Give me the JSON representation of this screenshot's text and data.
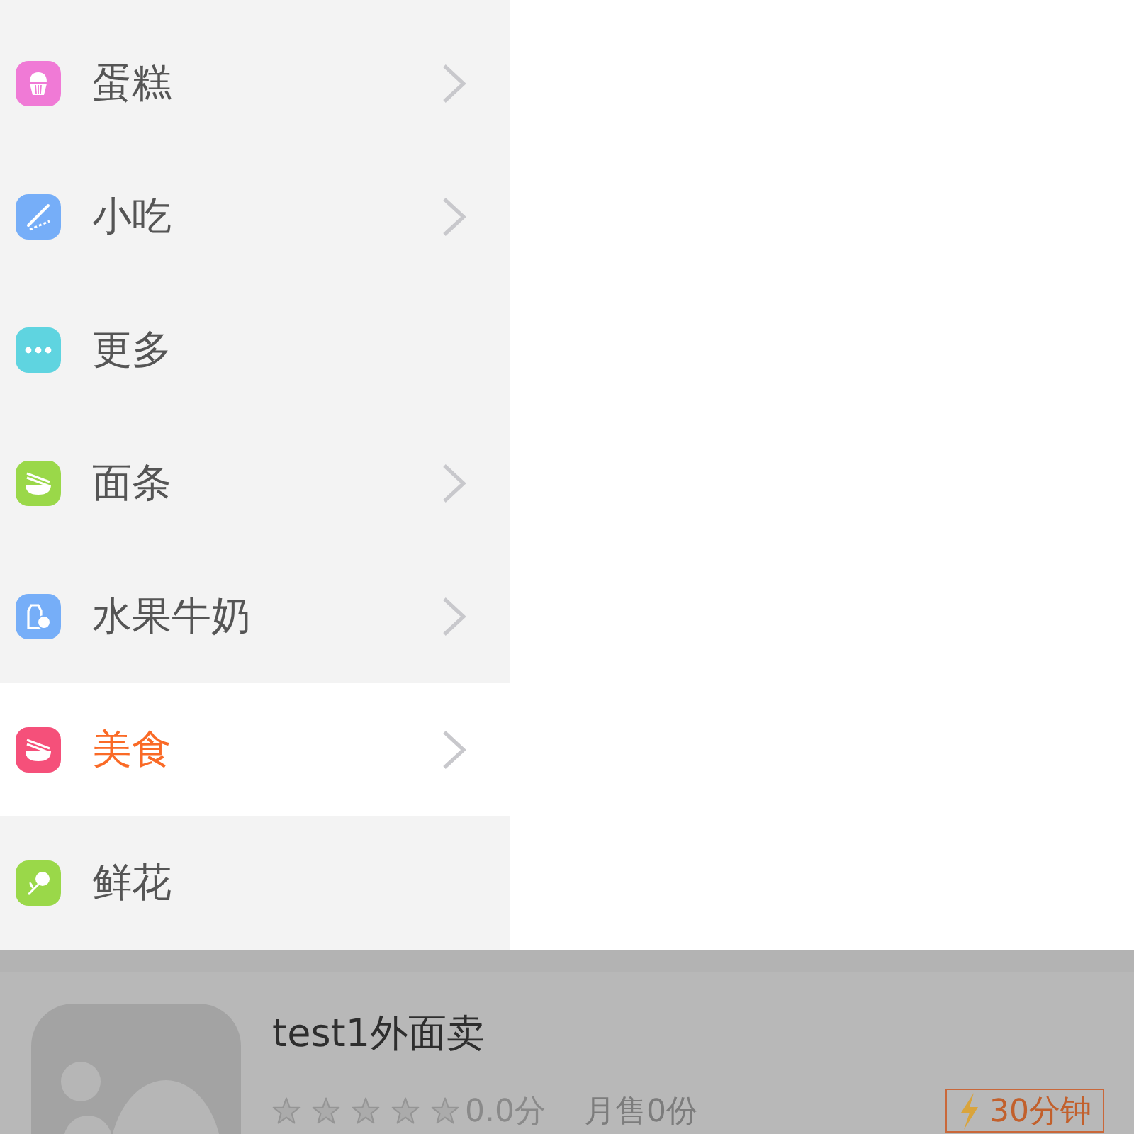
{
  "category_menu": {
    "items": [
      {
        "label": "蛋糕",
        "color": "#f07ad6",
        "has_submenu": true,
        "selected": false
      },
      {
        "label": "小吃",
        "color": "#76aef8",
        "has_submenu": true,
        "selected": false
      },
      {
        "label": "更多",
        "color": "#5fd4e0",
        "has_submenu": false,
        "selected": false
      },
      {
        "label": "面条",
        "color": "#9ad849",
        "has_submenu": true,
        "selected": false
      },
      {
        "label": "水果牛奶",
        "color": "#76aef8",
        "has_submenu": true,
        "selected": false
      },
      {
        "label": "美食",
        "color": "#f5507a",
        "has_submenu": true,
        "selected": true
      },
      {
        "label": "鲜花",
        "color": "#9ad849",
        "has_submenu": false,
        "selected": false
      }
    ]
  },
  "shop_card": {
    "name": "test1外面卖",
    "stars": 0,
    "score": "0.0分",
    "monthly_sales": "月售0份",
    "delivery_time": "30分钟"
  }
}
